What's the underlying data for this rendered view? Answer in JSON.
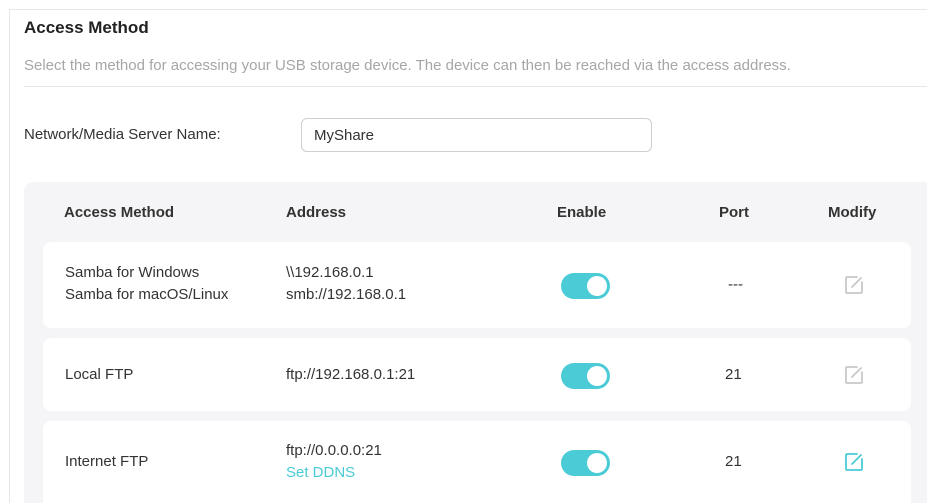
{
  "section": {
    "title": "Access Method",
    "description": "Select the method for accessing your USB storage device. The device can then be reached via the access address."
  },
  "server_name": {
    "label": "Network/Media Server Name:",
    "value": "MyShare"
  },
  "table": {
    "headers": {
      "method": "Access Method",
      "address": "Address",
      "enable": "Enable",
      "port": "Port",
      "modify": "Modify"
    },
    "rows": [
      {
        "method_line1": "Samba for Windows",
        "method_line2": "Samba for macOS/Linux",
        "address_line1": "\\\\192.168.0.1",
        "address_line2": "smb://192.168.0.1",
        "enabled": true,
        "port": "---",
        "modify_icon": "edit-icon",
        "modify_active": false
      },
      {
        "method_line1": "Local FTP",
        "address_line1": "ftp://192.168.0.1:21",
        "enabled": true,
        "port": "21",
        "modify_icon": "edit-icon",
        "modify_active": false
      },
      {
        "method_line1": "Internet FTP",
        "address_line1": "ftp://0.0.0.0:21",
        "address_link": "Set DDNS",
        "enabled": true,
        "port": "21",
        "modify_icon": "edit-icon",
        "modify_active": true
      }
    ]
  },
  "colors": {
    "accent": "#4acbd6",
    "panel_bg": "#f5f5f7",
    "icon_inactive": "#c8c8c8"
  }
}
